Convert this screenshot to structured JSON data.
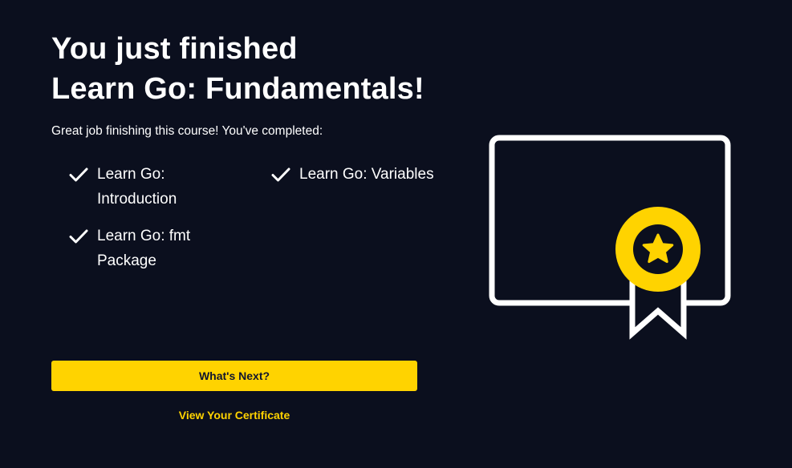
{
  "header": {
    "title_line1": "You just finished",
    "title_line2": "Learn Go: Fundamentals!"
  },
  "subtitle": "Great job finishing this course! You've completed:",
  "modules": [
    {
      "label": "Learn Go: Introduction",
      "icon": "checkmark-icon"
    },
    {
      "label": "Learn Go: Variables",
      "icon": "checkmark-icon"
    },
    {
      "label": "Learn Go: fmt Package",
      "icon": "checkmark-icon"
    }
  ],
  "actions": {
    "next_label": "What's Next?",
    "certificate_label": "View Your Certificate"
  },
  "illustration": {
    "icon": "certificate-icon",
    "accent_color": "#ffd300"
  },
  "colors": {
    "background": "#0b0f1e",
    "accent": "#ffd300",
    "text": "#ffffff"
  }
}
